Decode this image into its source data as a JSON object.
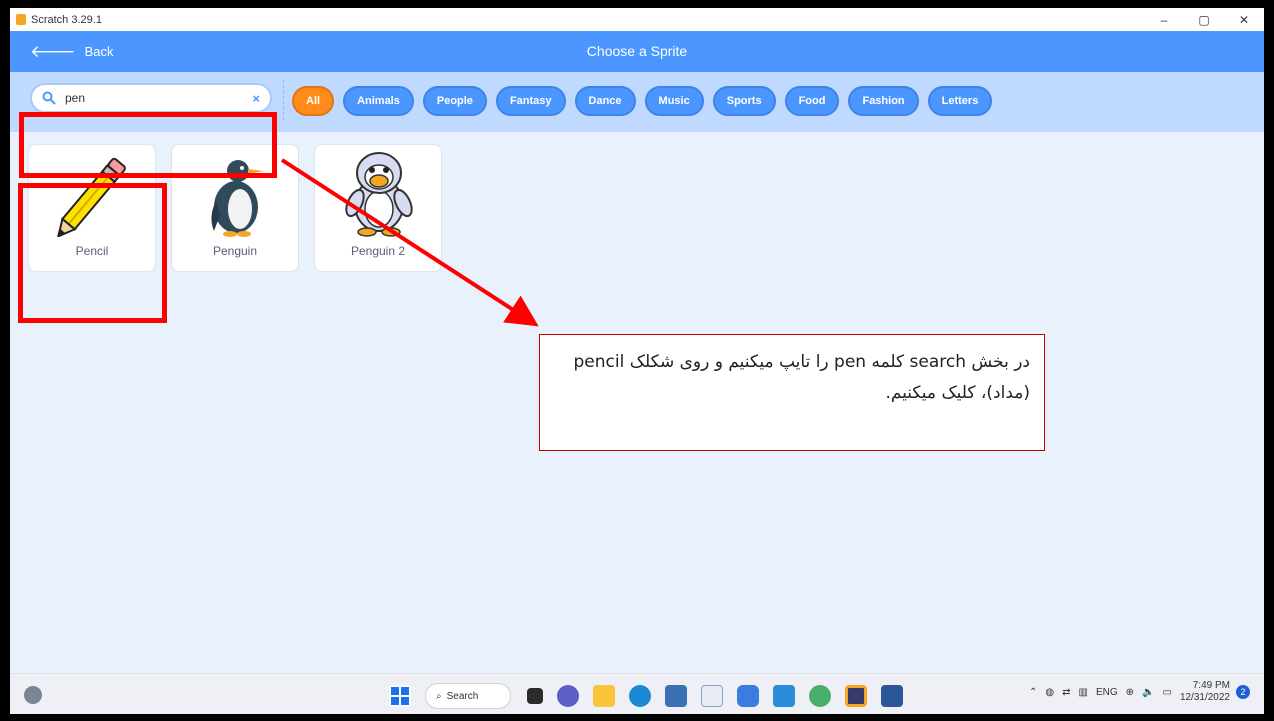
{
  "window": {
    "title": "Scratch 3.29.1",
    "controls": [
      "–",
      "▢",
      "✕"
    ]
  },
  "header": {
    "back_label": "Back",
    "title": "Choose a Sprite"
  },
  "search": {
    "value": "pen",
    "clear_symbol": "×"
  },
  "tags": [
    {
      "label": "All",
      "active": true
    },
    {
      "label": "Animals"
    },
    {
      "label": "People"
    },
    {
      "label": "Fantasy"
    },
    {
      "label": "Dance"
    },
    {
      "label": "Music"
    },
    {
      "label": "Sports"
    },
    {
      "label": "Food"
    },
    {
      "label": "Fashion"
    },
    {
      "label": "Letters"
    }
  ],
  "sprites": [
    {
      "label": "Pencil",
      "icon": "pencil-icon"
    },
    {
      "label": "Penguin",
      "icon": "penguin-icon"
    },
    {
      "label": "Penguin 2",
      "icon": "penguin-2-icon"
    }
  ],
  "annotation": {
    "text": "در بخش search کلمه pen را تایپ میکنیم و روی شکلک pencil (مداد)، کلیک میکنیم.",
    "color": "#ff0000"
  },
  "taskbar": {
    "search_label": "Search",
    "language": "ENG",
    "time": "7:49 PM",
    "date": "12/31/2022",
    "notification_count": "2"
  },
  "colors": {
    "header": "#4c97ff",
    "filter_bar": "#c0d9ff",
    "active_tag": "#ff8c1a",
    "tag": "#4c97ff",
    "background": "#e9f1fc"
  }
}
